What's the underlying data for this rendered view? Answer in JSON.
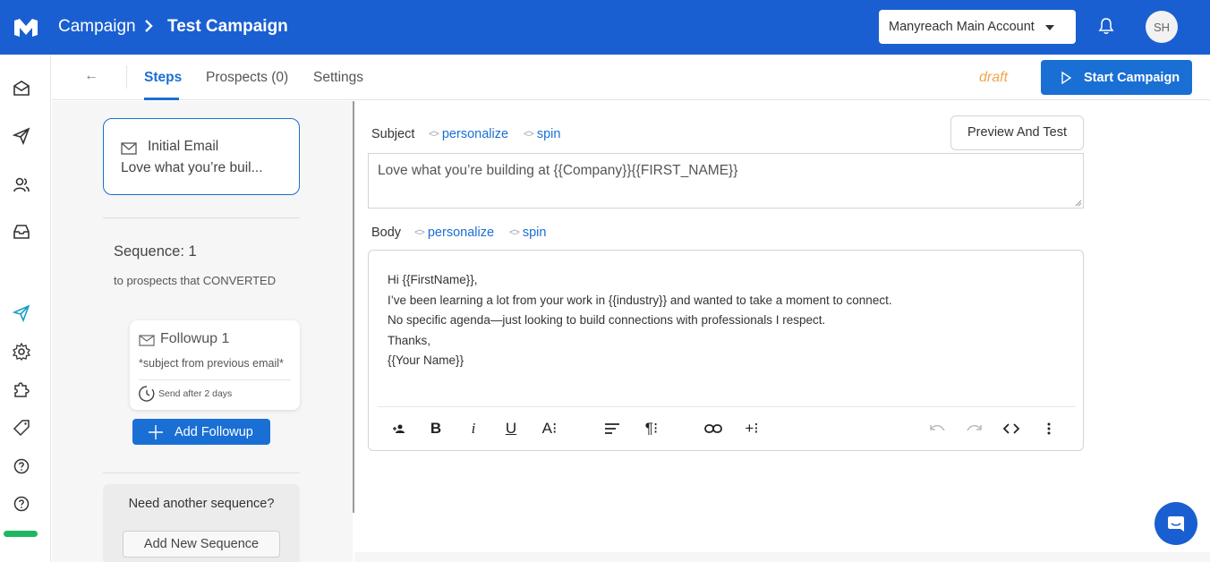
{
  "topbar": {
    "breadcrumb_parent": "Campaign",
    "breadcrumb_current": "Test Campaign",
    "account_label": "Manyreach Main Account",
    "avatar_initials": "SH",
    "brand_color": "#1a5fd1"
  },
  "rail": {
    "items": [
      "mail-icon",
      "send-icon",
      "users-icon",
      "inbox-icon",
      "campaign-send-icon",
      "gear-icon",
      "puzzle-icon",
      "tag-icon",
      "help-icon",
      "help-icon"
    ],
    "active_item": "campaign-send-icon"
  },
  "subheader": {
    "back_label": "←",
    "tabs": [
      {
        "label": "Steps",
        "active": true
      },
      {
        "label": "Prospects (0)",
        "active": false
      },
      {
        "label": "Settings",
        "active": false
      }
    ],
    "status": "draft",
    "start_label": "Start Campaign"
  },
  "steps": {
    "initial": {
      "title": "Initial Email",
      "preview": "Love what you’re buil..."
    },
    "sequence_title": "Sequence: 1",
    "sequence_sub": "to prospects that CONVERTED",
    "followup": {
      "title": "Followup 1",
      "subject": "*subject from previous email*",
      "send": "Send after 2 days"
    },
    "add_followup_label": "Add Followup",
    "need_label": "Need another sequence?",
    "add_sequence_label": "Add New Sequence"
  },
  "editor": {
    "subject_label": "Subject",
    "body_label": "Body",
    "personalize_label": "personalize",
    "spin_label": "spin",
    "preview_label": "Preview And Test",
    "subject_value": "Love what you’re building at {{Company}}{{FIRST_NAME}}",
    "body_lines": [
      "Hi {{FirstName}},",
      "I’ve been learning a lot from your work in {{industry}} and wanted to take a moment to connect.",
      "No specific agenda—just looking to build connections with professionals I respect.",
      "Thanks,",
      "{{Your Name}}"
    ],
    "toolbar": {
      "bold": "B",
      "italic": "i",
      "underline": "U",
      "font_size": "A⁝",
      "paragraph": "¶⁝",
      "insert": "+⁝"
    }
  }
}
